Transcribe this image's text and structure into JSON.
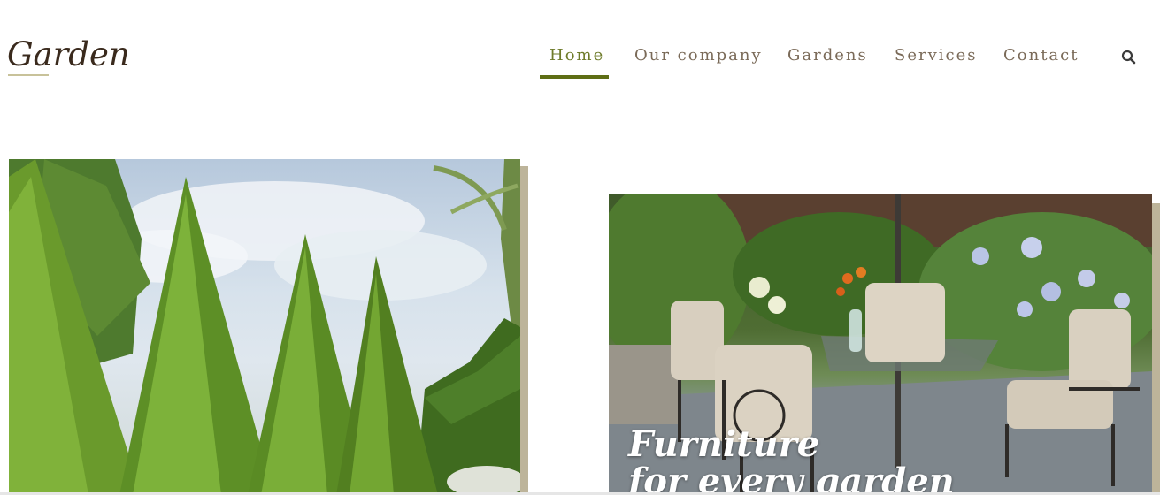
{
  "brand": {
    "logo_text": "Garden"
  },
  "nav": {
    "items": [
      {
        "label": "Home",
        "active": true
      },
      {
        "label": "Our company",
        "active": false
      },
      {
        "label": "Gardens",
        "active": false
      },
      {
        "label": "Services",
        "active": false
      },
      {
        "label": "Contact",
        "active": false
      }
    ],
    "search_icon": "search-icon"
  },
  "hero": {
    "left_image": {
      "subject": "topiary-cones-garden"
    },
    "right_image": {
      "subject": "patio-furniture-garden",
      "caption_line1": "Furniture",
      "caption_line2": "for every garden"
    }
  },
  "colors": {
    "accent": "#5e6e15",
    "active_nav_text": "#6e7b2a",
    "nav_text": "#7a6a58",
    "logo_text": "#3a2a1d",
    "image_shadow": "#bdb49a"
  }
}
